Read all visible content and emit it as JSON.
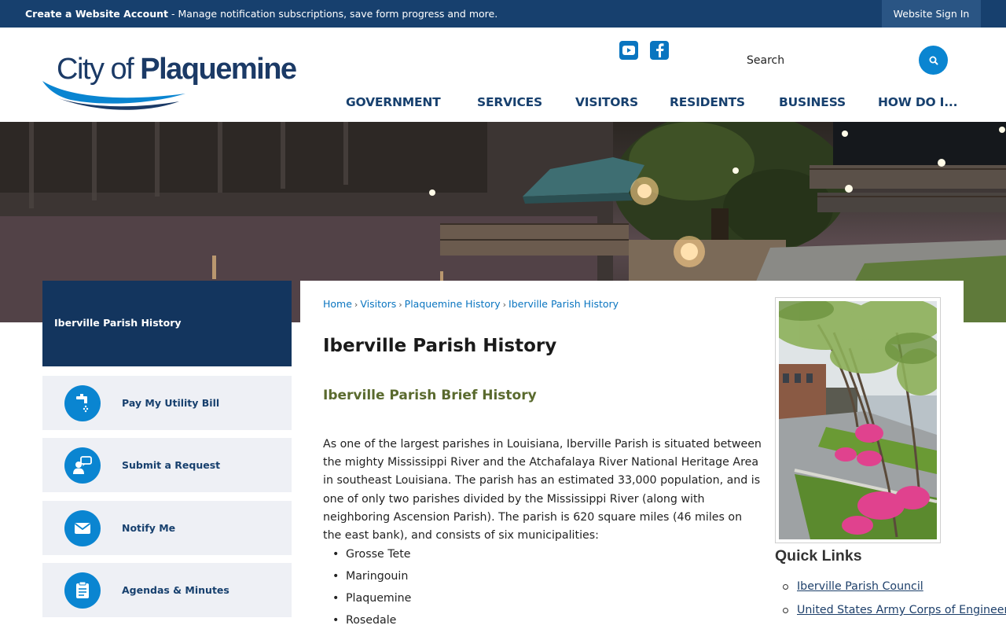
{
  "topbar": {
    "account_bold": "Create a Website Account",
    "account_text": " - Manage notification subscriptions, save form progress and more.",
    "signin": "Website Sign In"
  },
  "header": {
    "logo_light": "City of ",
    "logo_bold": "Plaquemine",
    "search_placeholder": "Search",
    "social": [
      {
        "icon": "youtube-icon"
      },
      {
        "icon": "facebook-icon"
      }
    ],
    "nav": [
      "GOVERNMENT",
      "SERVICES",
      "VISITORS",
      "RESIDENTS",
      "BUSINESS",
      "HOW DO I..."
    ]
  },
  "sidebar": {
    "title": "Iberville Parish History",
    "links": [
      {
        "label": "Pay My Utility Bill",
        "icon": "faucet-icon"
      },
      {
        "label": "Submit a Request",
        "icon": "person-chat-icon"
      },
      {
        "label": "Notify Me",
        "icon": "envelope-icon"
      },
      {
        "label": "Agendas & Minutes",
        "icon": "document-icon"
      }
    ]
  },
  "breadcrumb": [
    "Home",
    "Visitors",
    "Plaquemine History",
    "Iberville Parish History"
  ],
  "content": {
    "title": "Iberville Parish History",
    "subtitle": "Iberville Parish Brief History",
    "paragraph": "As one of the largest parishes in Louisiana, Iberville Parish is situated between the mighty Mississippi River and the Atchafalaya River National Heritage Area in southeast Louisiana. The parish has an estimated 33,000 population, and is one of only two parishes divided by the Mississippi River (along with neighboring Ascension Parish). The parish is 620 square miles (46 miles on the east bank), and consists of six municipalities:",
    "municipalities": [
      "Grosse Tete",
      "Maringouin",
      "Plaquemine",
      "Rosedale"
    ]
  },
  "quick_links": {
    "title": "Quick Links",
    "items": [
      "Iberville Parish Council",
      "United States Army Corps of Engineers"
    ]
  },
  "colors": {
    "navy": "#13355e",
    "topbar": "#17406e",
    "accent_blue": "#0a85d1",
    "subtitle_olive": "#5a6a2e"
  }
}
